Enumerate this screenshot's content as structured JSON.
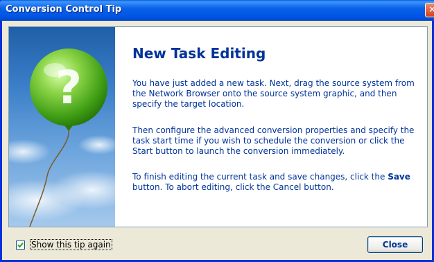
{
  "window": {
    "title": "Conversion Control Tip",
    "close_icon": "close-icon"
  },
  "tip": {
    "heading": "New Task Editing",
    "paragraph1": "You have just added a new task. Next, drag the source system from the Network Browser onto the source system graphic, and then specify the target location.",
    "paragraph2": "Then configure the advanced conversion properties and specify the task start time if you wish to schedule the conversion or click the Start button to launch the conversion immediately.",
    "paragraph3_before": "To finish editing the current task and save changes, click the ",
    "paragraph3_bold": "Save",
    "paragraph3_after": " button. To abort editing, click the Cancel button.",
    "illustration_icon": "question-balloon-icon"
  },
  "footer": {
    "checkbox_label": "Show this tip again",
    "checkbox_checked": true,
    "close_label": "Close"
  },
  "colors": {
    "title_blue": "#0a61e5",
    "text_blue": "#003399",
    "balloon_green": "#5cb82a"
  }
}
